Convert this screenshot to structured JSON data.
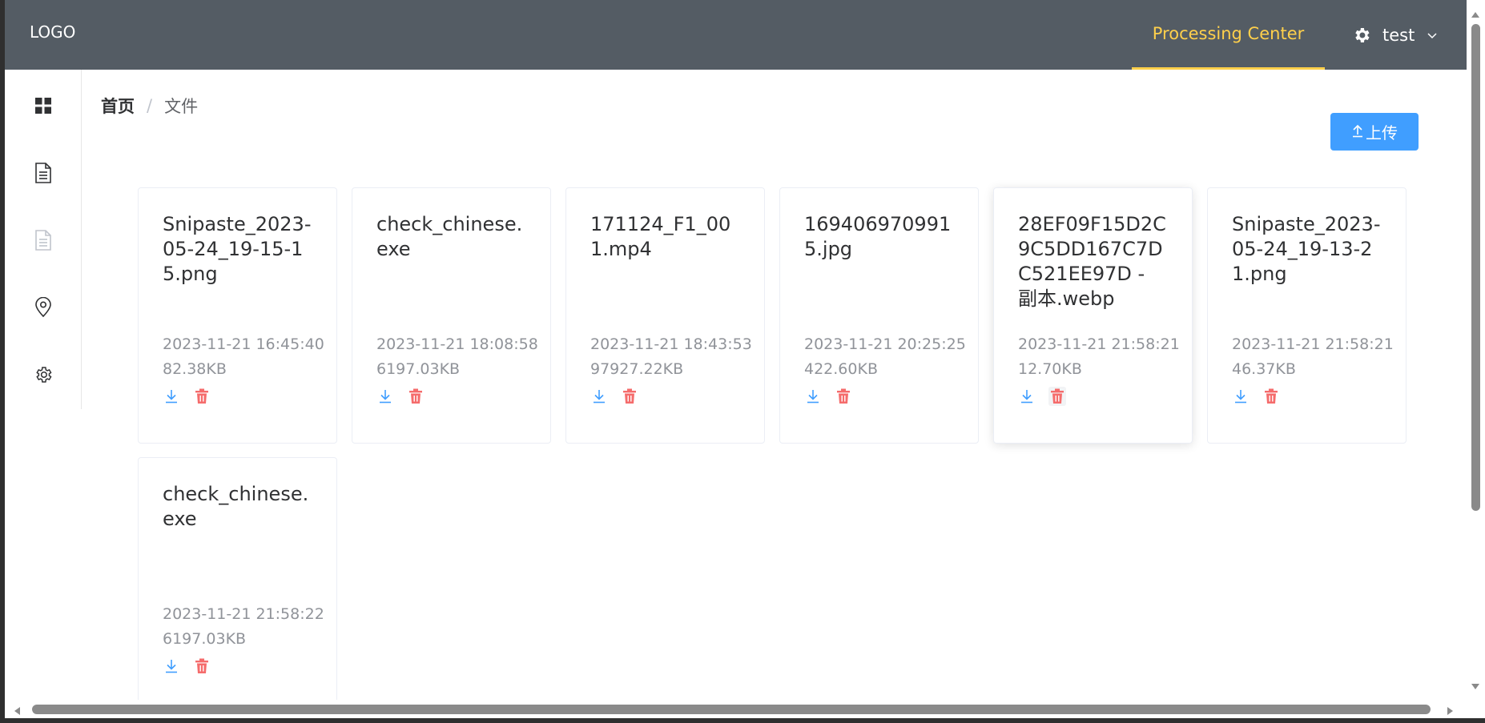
{
  "header": {
    "logo": "LOGO",
    "nav_active": "Processing Center",
    "user": "test",
    "colors": {
      "bg": "#545c64",
      "active": "#ffd04b"
    }
  },
  "sidebar": {
    "items": [
      {
        "icon": "grid-icon"
      },
      {
        "icon": "document-icon"
      },
      {
        "icon": "document-disabled-icon"
      },
      {
        "icon": "location-icon"
      },
      {
        "icon": "settings-icon"
      }
    ]
  },
  "breadcrumb": {
    "home": "首页",
    "separator": "/",
    "current": "文件"
  },
  "toolbar": {
    "upload_label": "上传",
    "upload_color": "#409eff"
  },
  "files": [
    {
      "name": "Snipaste_2023-05-24_19-15-15.png",
      "time": "2023-11-21 16:45:40",
      "size": "82.38KB"
    },
    {
      "name": "check_chinese.exe",
      "time": "2023-11-21 18:08:58",
      "size": "6197.03KB"
    },
    {
      "name": "171124_F1_001.mp4",
      "time": "2023-11-21 18:43:53",
      "size": "97927.22KB"
    },
    {
      "name": "1694069709915.jpg",
      "time": "2023-11-21 20:25:25",
      "size": "422.60KB"
    },
    {
      "name": "28EF09F15D2C9C5DD167C7DC521EE97D - 副本.webp",
      "time": "2023-11-21 21:58:21",
      "size": "12.70KB"
    },
    {
      "name": "Snipaste_2023-05-24_19-13-21.png",
      "time": "2023-11-21 21:58:21",
      "size": "46.37KB"
    },
    {
      "name": "check_chinese.exe",
      "time": "2023-11-21 21:58:22",
      "size": "6197.03KB"
    }
  ],
  "icons": {
    "download": "download-icon",
    "delete": "delete-icon",
    "download_color": "#409eff",
    "delete_color": "#f56c6c"
  }
}
